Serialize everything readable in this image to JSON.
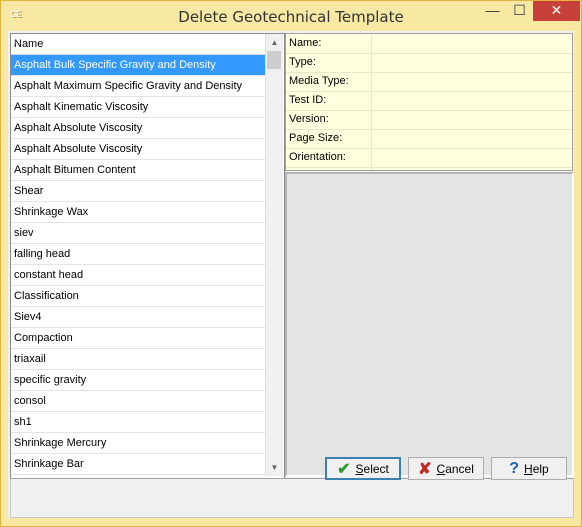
{
  "window": {
    "title": "Delete Geotechnical Template",
    "icon_text": "GE",
    "controls": {
      "minimize": "—",
      "maximize": "☐",
      "close": "✕"
    }
  },
  "list": {
    "header": "Name",
    "sort_indicator": "/",
    "items": [
      "Asphalt Bulk Specific Gravity and Density",
      "Asphalt Maximum Specific Gravity and Density",
      "Asphalt Kinematic Viscosity",
      "Asphalt Absolute Viscosity",
      "Asphalt Absolute Viscosity",
      "Asphalt Bitumen Content",
      "Shear",
      "Shrinkage Wax",
      "siev",
      "falling head",
      "constant head",
      "Classification",
      "Siev4",
      "Compaction",
      "triaxail",
      "specific gravity",
      "consol",
      "sh1",
      "Shrinkage Mercury",
      "Shrinkage Bar"
    ],
    "selected_index": 0
  },
  "properties": {
    "labels": [
      "Name:",
      "Type:",
      "Media Type:",
      "Test ID:",
      "Version:",
      "Page Size:",
      "Orientation:"
    ],
    "values": [
      "",
      "",
      "",
      "",
      "",
      "",
      ""
    ]
  },
  "buttons": {
    "select": {
      "pre": "",
      "accel": "S",
      "post": "elect"
    },
    "cancel": {
      "pre": "",
      "accel": "C",
      "post": "ancel"
    },
    "help": {
      "pre": "",
      "accel": "H",
      "post": "elp"
    }
  },
  "icons": {
    "select": "check-icon",
    "cancel": "x-icon",
    "help": "question-icon"
  },
  "colors": {
    "title_bar": "#F7E8A4",
    "selection": "#3399FF",
    "properties_bg": "#FFFFE0",
    "close_button": "#C7413A"
  }
}
